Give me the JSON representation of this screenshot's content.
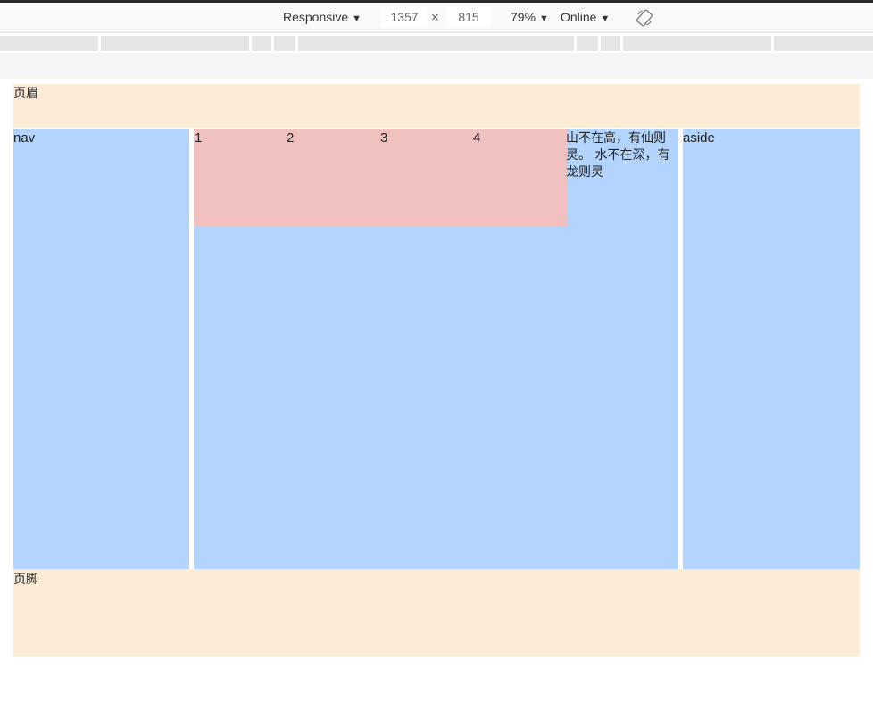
{
  "devtools": {
    "device_mode": "Responsive",
    "width": "1357",
    "times_sign": "×",
    "height": "815",
    "zoom": "79%",
    "network": "Online",
    "caret": "▼",
    "rotate_icon": "rotate-icon"
  },
  "page": {
    "header": "页眉",
    "nav": "nav",
    "items": [
      "1",
      "2",
      "3",
      "4"
    ],
    "poem": "山不在高，有仙则灵。 水不在深，有龙则灵",
    "aside": "aside",
    "footer": "页脚"
  },
  "colors": {
    "header_footer": "#fbebd7",
    "columns": "#b3d4fd",
    "flex_container": "#f1c1c0"
  }
}
